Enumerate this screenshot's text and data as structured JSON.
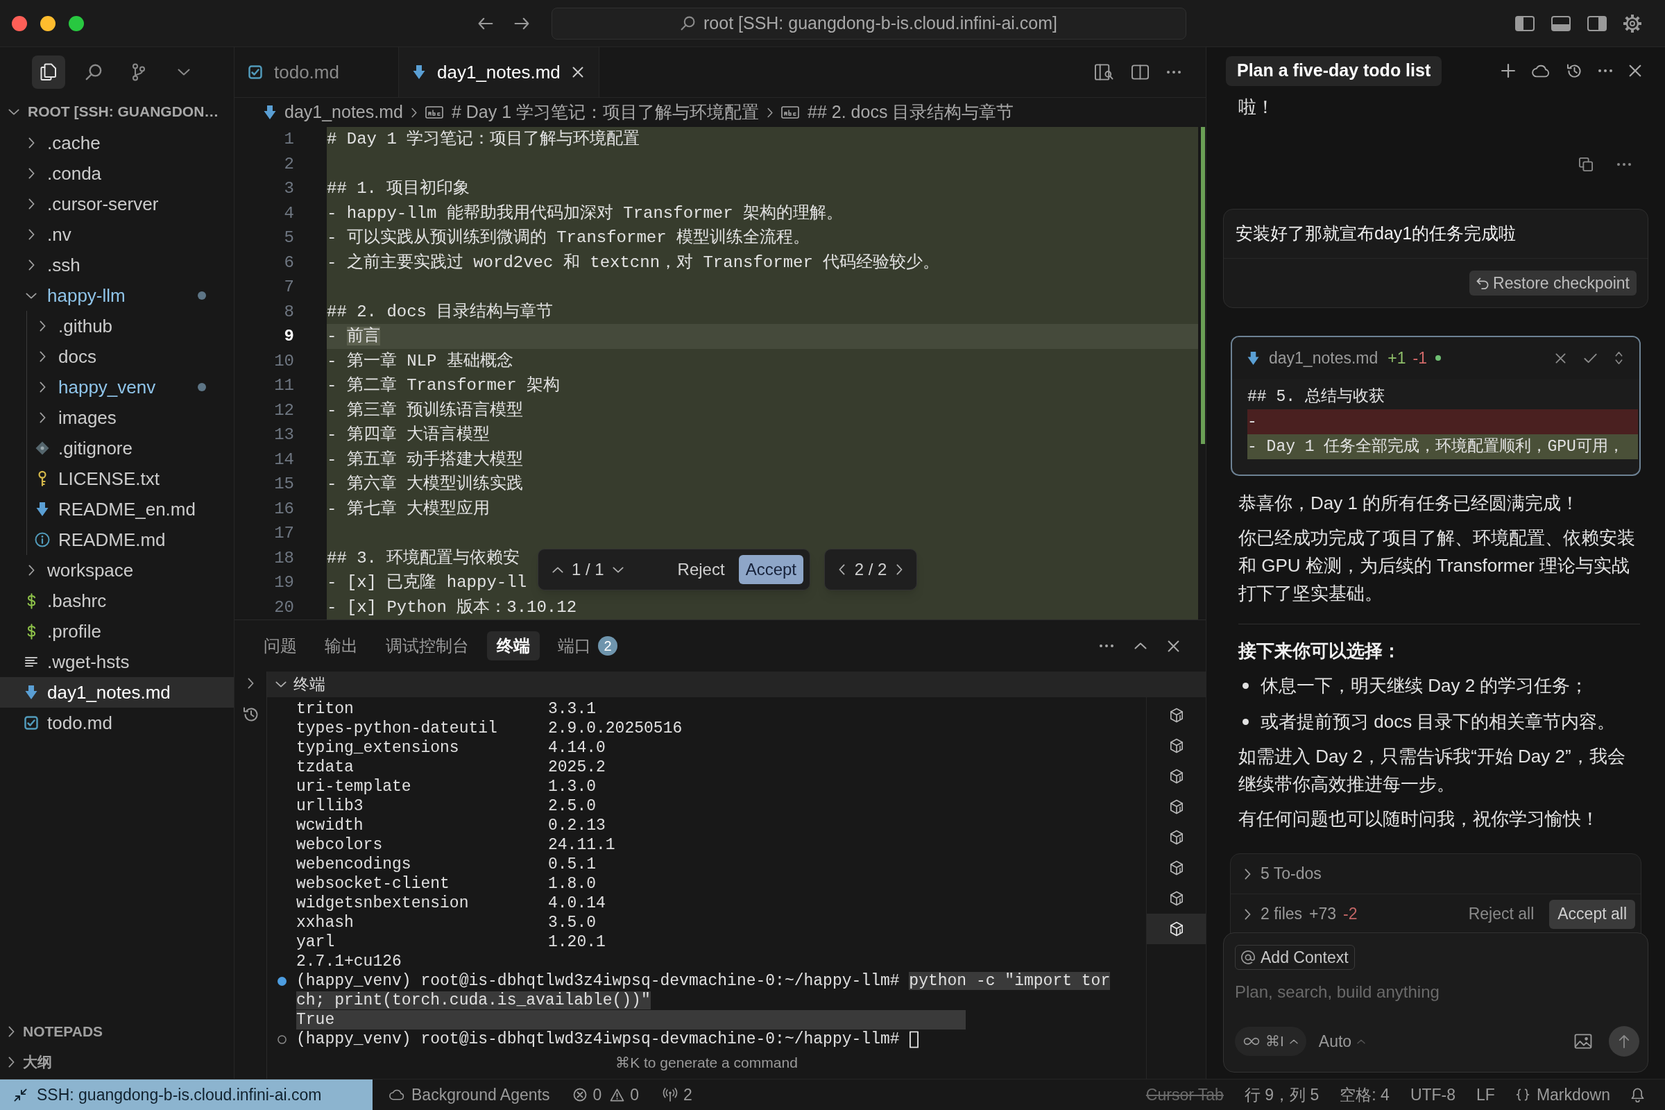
{
  "window": {
    "title": "root [SSH: guangdong-b-is.cloud.infini-ai.com]"
  },
  "activity_bar": [
    {
      "kind": "files",
      "selected": true
    },
    {
      "kind": "search",
      "selected": false
    },
    {
      "kind": "source-control",
      "selected": false
    },
    {
      "kind": "more",
      "selected": false
    }
  ],
  "explorer": {
    "root": "ROOT [SSH: GUANGDON…",
    "tree": [
      {
        "label": ".cache",
        "kind": "folder",
        "expanded": false,
        "modified": false,
        "selected": false
      },
      {
        "label": ".conda",
        "kind": "folder",
        "expanded": false,
        "modified": false,
        "selected": false
      },
      {
        "label": ".cursor-server",
        "kind": "folder",
        "expanded": false,
        "modified": false,
        "selected": false
      },
      {
        "label": ".nv",
        "kind": "folder",
        "expanded": false,
        "modified": false,
        "selected": false
      },
      {
        "label": ".ssh",
        "kind": "folder",
        "expanded": false,
        "modified": false,
        "selected": false
      },
      {
        "label": "happy-llm",
        "kind": "folder",
        "expanded": true,
        "modified": true,
        "selected": false,
        "children": [
          {
            "label": ".github",
            "kind": "folder",
            "expanded": false,
            "modified": false,
            "selected": false
          },
          {
            "label": "docs",
            "kind": "folder",
            "expanded": false,
            "modified": false,
            "selected": false
          },
          {
            "label": "happy_venv",
            "kind": "folder",
            "expanded": false,
            "modified": true,
            "selected": false
          },
          {
            "label": "images",
            "kind": "folder",
            "expanded": false,
            "modified": false,
            "selected": false
          },
          {
            "label": ".gitignore",
            "kind": "gitignore",
            "modified": false,
            "selected": false
          },
          {
            "label": "LICENSE.txt",
            "kind": "license",
            "modified": false,
            "selected": false
          },
          {
            "label": "README_en.md",
            "kind": "markdown",
            "modified": false,
            "selected": false
          },
          {
            "label": "README.md",
            "kind": "info",
            "modified": false,
            "selected": false
          }
        ]
      },
      {
        "label": "workspace",
        "kind": "folder",
        "expanded": false,
        "modified": false,
        "selected": false
      },
      {
        "label": ".bashrc",
        "kind": "shell",
        "modified": false,
        "selected": false
      },
      {
        "label": ".profile",
        "kind": "shell",
        "modified": false,
        "selected": false
      },
      {
        "label": ".wget-hsts",
        "kind": "list",
        "modified": false,
        "selected": false
      },
      {
        "label": "day1_notes.md",
        "kind": "markdown",
        "modified": false,
        "selected": true
      },
      {
        "label": "todo.md",
        "kind": "todo",
        "modified": false,
        "selected": false
      }
    ],
    "sections": [
      {
        "label": "NOTEPADS",
        "expanded": false
      },
      {
        "label": "大纲",
        "expanded": false
      }
    ]
  },
  "editor": {
    "tabs": [
      {
        "label": "todo.md",
        "kind": "todo",
        "selected": false
      },
      {
        "label": "day1_notes.md",
        "kind": "markdown",
        "selected": true
      }
    ],
    "breadcrumbs": [
      {
        "label": "day1_notes.md",
        "kind": "file"
      },
      {
        "label": "# Day 1 学习笔记：项目了解与环境配置",
        "kind": "heading"
      },
      {
        "label": "## 2. docs 目录结构与章节",
        "kind": "heading"
      }
    ],
    "lines": [
      {
        "number": "1",
        "text": "# Day 1 学习笔记：项目了解与环境配置",
        "added": true,
        "current": false
      },
      {
        "number": "2",
        "added": true,
        "current": false
      },
      {
        "number": "3",
        "text": "## 1. 项目初印象",
        "added": true,
        "current": false
      },
      {
        "number": "4",
        "text": "- happy-llm 能帮助我用代码加深对 Transformer 架构的理解。",
        "added": true,
        "current": false
      },
      {
        "number": "5",
        "text": "- 可以实践从预训练到微调的 Transformer 模型训练全流程。",
        "added": true,
        "current": false
      },
      {
        "number": "6",
        "text": "- 之前主要实践过 word2vec 和 textcnn，对 Transformer 代码经验较少。",
        "added": true,
        "current": false
      },
      {
        "number": "7",
        "added": true,
        "current": false
      },
      {
        "number": "8",
        "text": "## 2. docs 目录结构与章节",
        "added": true,
        "current": false
      },
      {
        "number": "9",
        "text": "- ",
        "highlight": "前言",
        "added": true,
        "current": true
      },
      {
        "number": "10",
        "text": "- 第一章 NLP 基础概念",
        "added": true,
        "current": false
      },
      {
        "number": "11",
        "text": "- 第二章 Transformer 架构",
        "added": true,
        "current": false
      },
      {
        "number": "12",
        "text": "- 第三章 预训练语言模型",
        "added": true,
        "current": false
      },
      {
        "number": "13",
        "text": "- 第四章 大语言模型",
        "added": true,
        "current": false
      },
      {
        "number": "14",
        "text": "- 第五章 动手搭建大模型",
        "added": true,
        "current": false
      },
      {
        "number": "15",
        "text": "- 第六章 大模型训练实践",
        "added": true,
        "current": false
      },
      {
        "number": "16",
        "text": "- 第七章 大模型应用",
        "added": true,
        "current": false
      },
      {
        "number": "17",
        "added": true,
        "current": false
      },
      {
        "number": "18",
        "text": "## 3. 环境配置与依赖安",
        "added": true,
        "current": false
      },
      {
        "number": "19",
        "text": "- [x] 已克隆 happy-ll",
        "added": true,
        "current": false
      },
      {
        "number": "20",
        "text": "- [x] Python 版本：3.10.12",
        "added": true,
        "current": false
      }
    ],
    "diff_toolbar": {
      "hunk": "1 / 1",
      "reject": "Reject",
      "accept": "Accept",
      "file": "2 / 2"
    }
  },
  "panel": {
    "tabs": [
      {
        "label": "问题",
        "selected": false
      },
      {
        "label": "输出",
        "selected": false
      },
      {
        "label": "调试控制台",
        "selected": false
      },
      {
        "label": "终端",
        "selected": true
      },
      {
        "label": "端口",
        "selected": false,
        "badge": "2"
      }
    ],
    "terminal": {
      "title": "终端",
      "entries": [
        {
          "kind": "package",
          "name": "triton",
          "version": "3.3.1"
        },
        {
          "kind": "package",
          "name": "types-python-dateutil",
          "version": "2.9.0.20250516"
        },
        {
          "kind": "package",
          "name": "typing_extensions",
          "version": "4.14.0"
        },
        {
          "kind": "package",
          "name": "tzdata",
          "version": "2025.2"
        },
        {
          "kind": "package",
          "name": "uri-template",
          "version": "1.3.0"
        },
        {
          "kind": "package",
          "name": "urllib3",
          "version": "2.5.0"
        },
        {
          "kind": "package",
          "name": "wcwidth",
          "version": "0.2.13"
        },
        {
          "kind": "package",
          "name": "webcolors",
          "version": "24.11.1"
        },
        {
          "kind": "package",
          "name": "webencodings",
          "version": "0.5.1"
        },
        {
          "kind": "package",
          "name": "websocket-client",
          "version": "1.8.0"
        },
        {
          "kind": "package",
          "name": "widgetsnbextension",
          "version": "4.0.14"
        },
        {
          "kind": "package",
          "name": "xxhash",
          "version": "3.5.0"
        },
        {
          "kind": "package",
          "name": "yarl",
          "version": "1.20.1"
        },
        {
          "kind": "output",
          "text": "2.7.1+cu126"
        },
        {
          "kind": "command",
          "prompt": "(happy_venv) root@is-dbhqtlwd3z4iwpsq-devmachine-0:~/happy-llm#",
          "command": "python -c \"import torch; print(torch.cuda.is_available())\"",
          "output": "True",
          "succeeded": true,
          "highlighted": true
        },
        {
          "kind": "command",
          "prompt": "(happy_venv) root@is-dbhqtlwd3z4iwpsq-devmachine-0:~/happy-llm#",
          "succeeded": false,
          "highlighted": false
        }
      ],
      "hint": "⌘K to generate a command",
      "instances": [
        {
          "selected": false
        },
        {
          "selected": false
        },
        {
          "selected": false
        },
        {
          "selected": false
        },
        {
          "selected": false
        },
        {
          "selected": false
        },
        {
          "selected": false
        },
        {
          "selected": true
        }
      ]
    }
  },
  "chat": {
    "title": "Plan a five-day todo list",
    "previous": "啦！",
    "user_message": {
      "text": "安装好了那就宣布day1的任务完成啦",
      "restore": "Restore checkpoint"
    },
    "diff_card": {
      "file": "day1_notes.md",
      "added": "+1",
      "removed": "-1",
      "lines": [
        {
          "kind": "context",
          "text": "## 5. 总结与收获"
        },
        {
          "kind": "removed",
          "text": "-"
        },
        {
          "kind": "added",
          "text": "- Day 1 任务全部完成，环境配置顺利，GPU可用，"
        }
      ]
    },
    "response": [
      {
        "kind": "paragraph",
        "text": "恭喜你，Day 1 的所有任务已经圆满完成！"
      },
      {
        "kind": "paragraph",
        "text": "你已经成功完成了项目了解、环境配置、依赖安装和 GPU 检测，为后续的 Transformer 理论与实战打下了坚实基础。"
      },
      {
        "kind": "divider"
      },
      {
        "kind": "heading",
        "text": "接下来你可以选择："
      },
      {
        "kind": "bullets",
        "items": [
          "休息一下，明天继续 Day 2 的学习任务；",
          "或者提前预习 docs 目录下的相关章节内容。"
        ]
      },
      {
        "kind": "paragraph",
        "text": "如需进入 Day 2，只需告诉我“开始 Day 2”，我会继续带你高效推进每一步。"
      },
      {
        "kind": "paragraph",
        "text": "有任何问题也可以随时问我，祝你学习愉快！"
      }
    ],
    "todos": {
      "label": "5 To-dos",
      "expanded": false
    },
    "changes": {
      "label": "2 files",
      "added": "+73",
      "removed": "-2",
      "expanded": false,
      "reject": "Reject all",
      "accept": "Accept all"
    },
    "composer": {
      "context": "Add Context",
      "placeholder": "Plan, search, build anything",
      "mode": "⌘I",
      "model": "Auto"
    }
  },
  "status_bar": {
    "remote": "SSH: guangdong-b-is.cloud.infini-ai.com",
    "agents": "Background Agents",
    "errors": "0",
    "warnings": "0",
    "ports": "2",
    "items": [
      {
        "label": "Cursor Tab",
        "disabled": true
      },
      {
        "label": "行 9，列 5",
        "disabled": false
      },
      {
        "label": "空格: 4",
        "disabled": false
      },
      {
        "label": "UTF-8",
        "disabled": false
      },
      {
        "label": "LF",
        "disabled": false
      }
    ],
    "language": "Markdown"
  }
}
